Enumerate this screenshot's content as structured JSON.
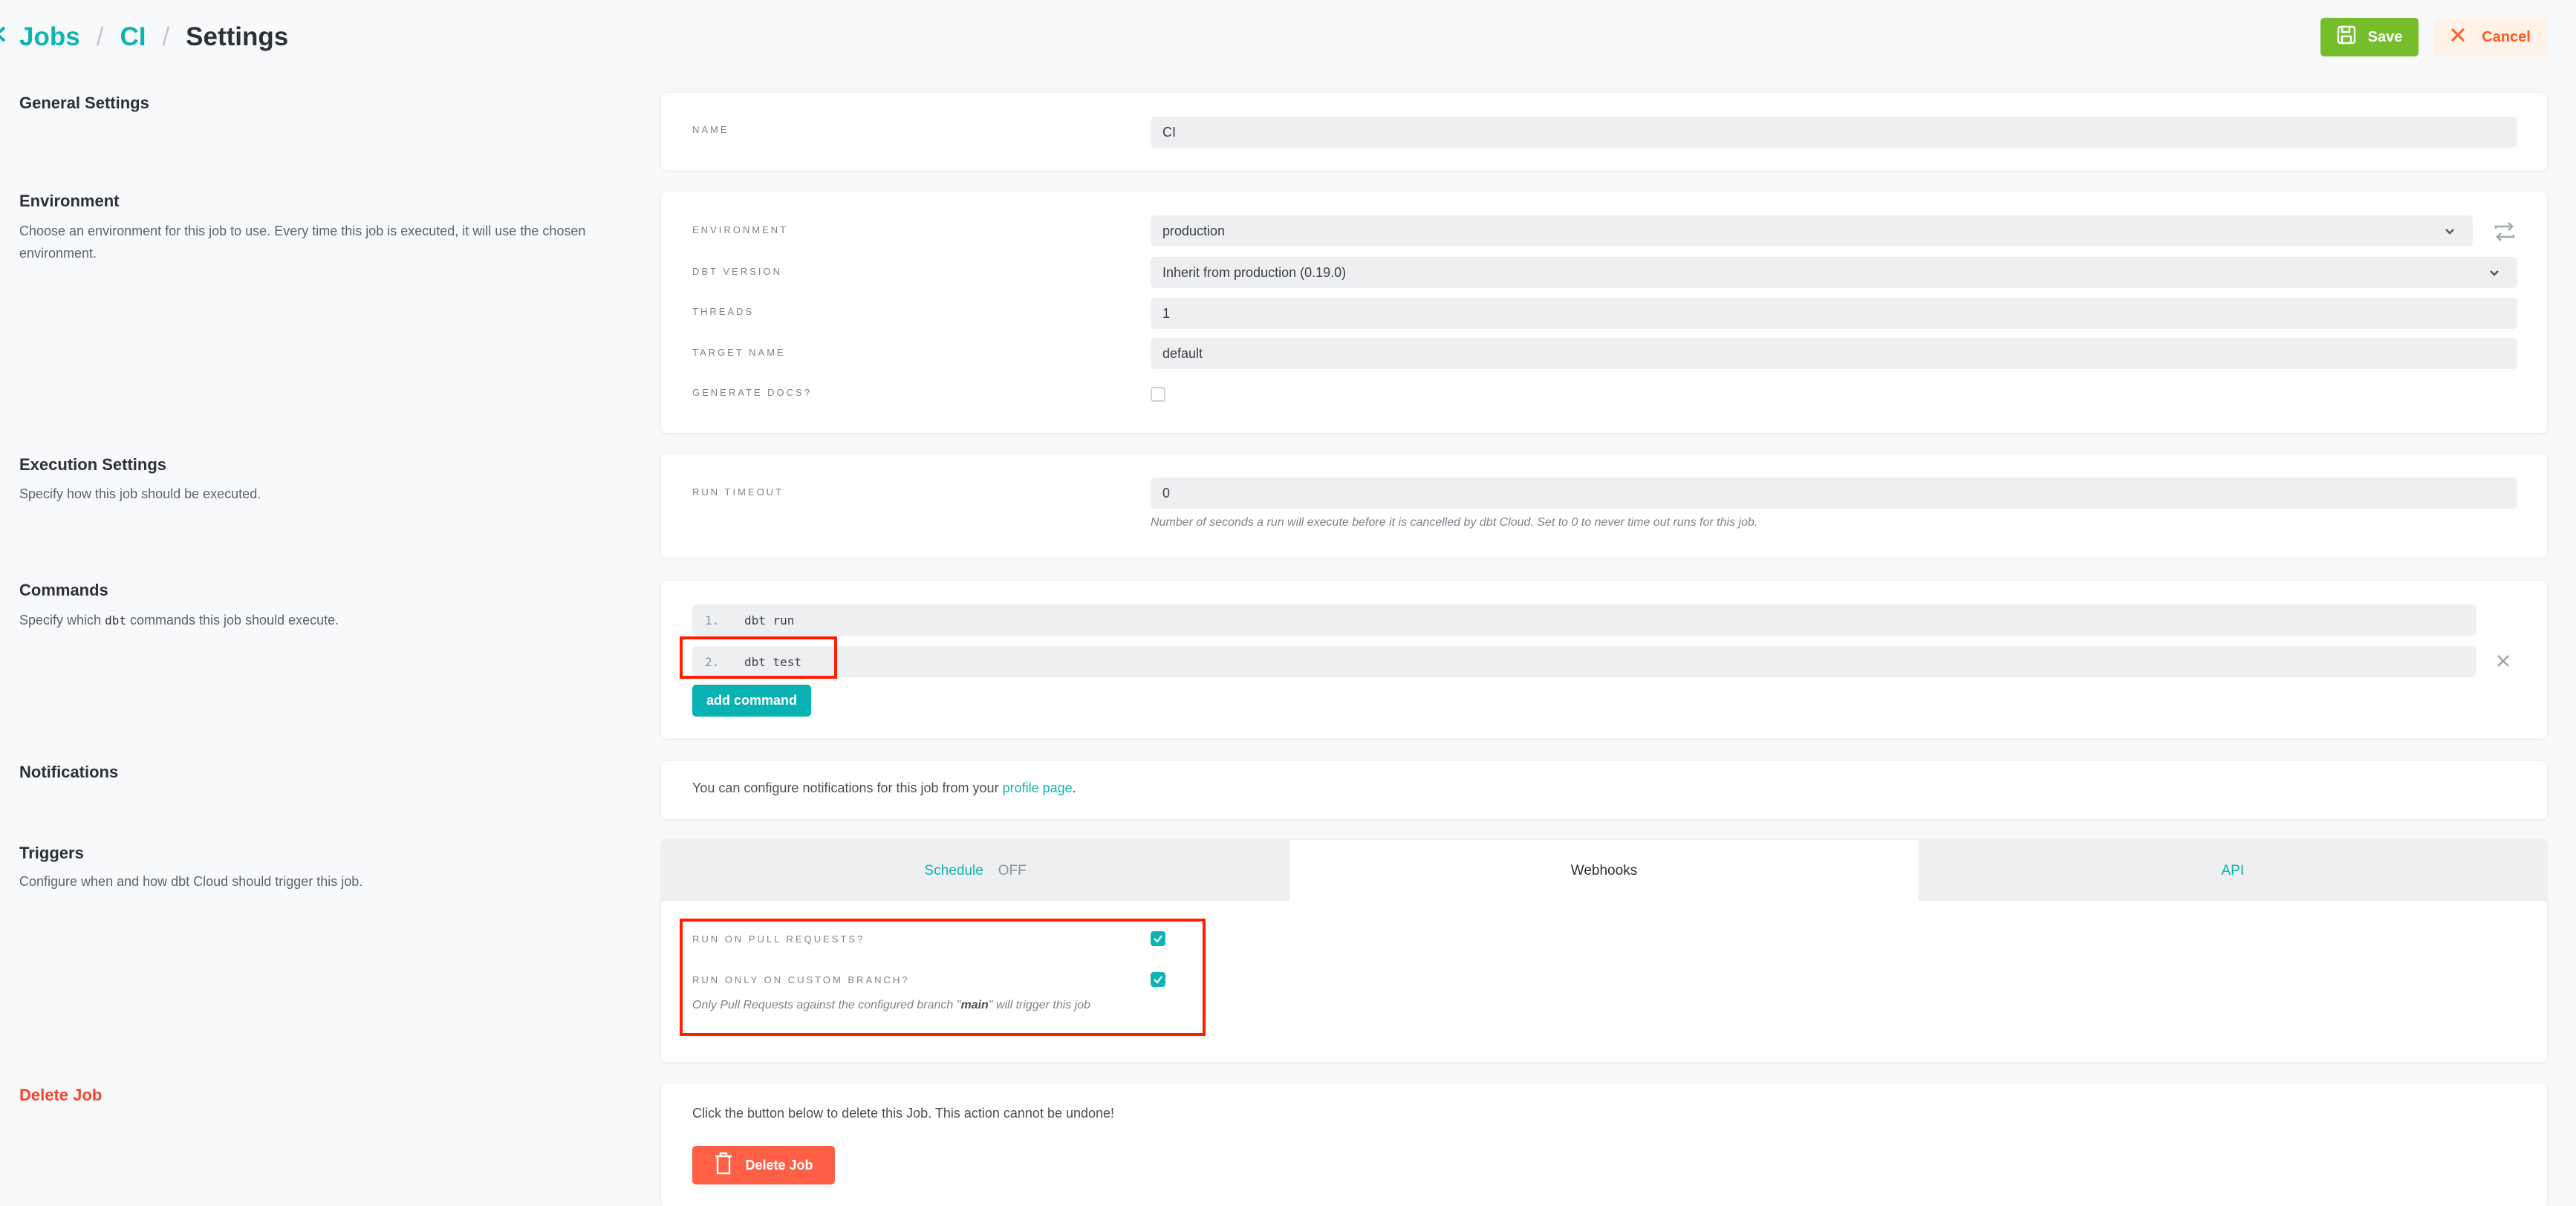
{
  "breadcrumb": {
    "back_icon": "chevron-left-icon",
    "items": [
      "Jobs",
      "CI"
    ],
    "separator": "/",
    "current": "Settings"
  },
  "toolbar": {
    "save_label": "Save",
    "save_icon": "floppy-disk-icon",
    "cancel_label": "Cancel",
    "cancel_icon": "close-icon"
  },
  "sections": {
    "general": {
      "title": "General Settings"
    },
    "environment": {
      "title": "Environment",
      "description": "Choose an environment for this job to use. Every time this job is executed, it will use the chosen environment."
    },
    "execution": {
      "title": "Execution Settings",
      "description": "Specify how this job should be executed."
    },
    "commands": {
      "title": "Commands",
      "description_before": "Specify which ",
      "description_code": "dbt",
      "description_after": " commands this job should execute."
    },
    "notifications": {
      "title": "Notifications"
    },
    "triggers": {
      "title": "Triggers",
      "description": "Configure when and how dbt Cloud should trigger this job."
    },
    "delete": {
      "title": "Delete Job"
    }
  },
  "general": {
    "name_label": "Name",
    "name_value": "CI"
  },
  "environment": {
    "environment_label": "Environment",
    "environment_value": "production",
    "dbt_version_label": "dbt Version",
    "dbt_version_value": "Inherit from production (0.19.0)",
    "threads_label": "Threads",
    "threads_value": "1",
    "target_name_label": "Target Name",
    "target_name_value": "default",
    "generate_docs_label": "Generate Docs?",
    "generate_docs_checked": false
  },
  "execution": {
    "run_timeout_label": "Run Timeout",
    "run_timeout_value": "0",
    "run_timeout_hint": "Number of seconds a run will execute before it is cancelled by dbt Cloud. Set to 0 to never time out runs for this job."
  },
  "commands": {
    "items": [
      {
        "num": "1.",
        "command": "dbt run"
      },
      {
        "num": "2.",
        "command": "dbt test"
      }
    ],
    "add_label": "add command"
  },
  "notifications": {
    "text_before": "You can configure notifications for this job from your ",
    "link_text": "profile page",
    "text_after": "."
  },
  "triggers": {
    "tabs": [
      {
        "label": "Schedule",
        "status": "OFF",
        "active": false
      },
      {
        "label": "Webhooks",
        "active": true
      },
      {
        "label": "API",
        "active": false
      }
    ],
    "run_on_pr_label": "Run on Pull Requests?",
    "run_on_pr_checked": true,
    "custom_branch_label": "Run only on custom branch?",
    "custom_branch_checked": true,
    "custom_branch_hint_before": "Only Pull Requests against the configured branch \"",
    "custom_branch_hint_branch": "main",
    "custom_branch_hint_after": "\" will trigger this job"
  },
  "delete": {
    "text": "Click the button below to delete this Job. This action cannot be undone!",
    "button_label": "Delete Job",
    "button_icon": "trash-icon"
  },
  "colors": {
    "accent": "#10b3b4",
    "save": "#77be2d",
    "cancel_text": "#fa5d1f",
    "danger": "#ff5f45",
    "annotation": "#ff1e00"
  }
}
